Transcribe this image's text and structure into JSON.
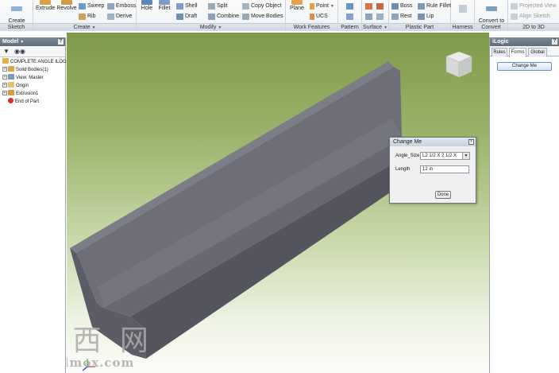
{
  "ribbon": {
    "sketch": {
      "title": "Sketch",
      "create_2d_sketch": "Create\n2D Sketch"
    },
    "create": {
      "title": "Create",
      "extrude": "Extrude",
      "revolve": "Revolve",
      "sweep": "Sweep",
      "emboss": "Emboss",
      "rib": "Rib",
      "derive": "Derive"
    },
    "modify": {
      "title": "Modify",
      "hole": "Hole",
      "fillet": "Fillet",
      "shell": "Shell",
      "draft": "Draft",
      "split": "Split",
      "combine": "Combine",
      "copy_object": "Copy Object",
      "move_bodies": "Move Bodies"
    },
    "work_features": {
      "title": "Work Features",
      "plane": "Plane",
      "point": "Point",
      "ucs": "UCS"
    },
    "pattern": {
      "title": "Pattern"
    },
    "surface": {
      "title": "Surface"
    },
    "plastic_part": {
      "title": "Plastic Part",
      "boss": "Boss",
      "rule_fillet": "Rule Fillet",
      "rest": "Rest",
      "lip": "Lip"
    },
    "harness": {
      "title": "Harness"
    },
    "convert": {
      "title": "Convert",
      "convert_to_sheet_metal": "Convert to\nSheet Metal"
    },
    "twod_to_3d": {
      "title": "2D to 3D",
      "projected_view": "Projected View",
      "align_sketch": "Align Sketch"
    }
  },
  "model_panel": {
    "title": "Model",
    "help": "?",
    "tree": [
      {
        "label": "COMPLETE ANGLE ILOGIC.ipt"
      },
      {
        "label": "Solid Bodies(1)"
      },
      {
        "label": "View: Master"
      },
      {
        "label": "Origin"
      },
      {
        "label": "Extrusion1"
      },
      {
        "label": "End of Part"
      }
    ]
  },
  "dialog": {
    "title": "Change Me",
    "close": "x",
    "angle_size_label": "Angle_Size",
    "angle_size_value": "L2 1/2 X 2 1/2 X",
    "length_label": "Length",
    "length_value": "12 in",
    "done": "Done"
  },
  "ilogic_panel": {
    "title": "iLogic",
    "help": "?",
    "tabs": [
      "Rules",
      "Forms",
      "Global"
    ],
    "change_me_button": "Change Me"
  },
  "watermark": {
    "chars": "莫 西 网",
    "url": "www.3dmox.com"
  },
  "colors": {
    "part": "#6f6f7a",
    "bg_top": "#7e9a4a",
    "bg_bottom": "#fbfcf8",
    "ribbon_panel_title": "#cfd7e0"
  }
}
